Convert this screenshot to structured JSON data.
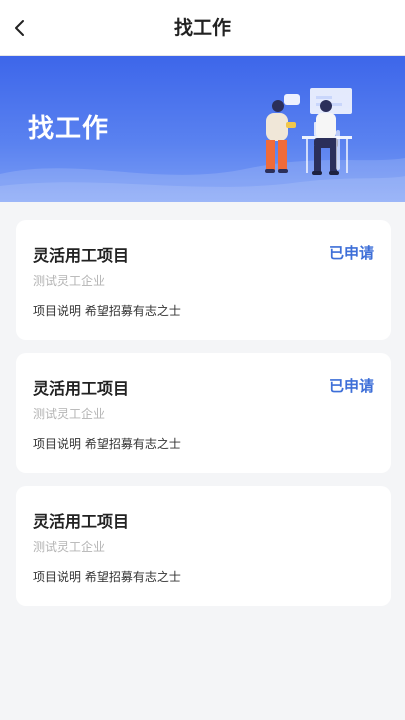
{
  "header": {
    "title": "找工作",
    "back_icon": "chevron-left-icon"
  },
  "banner": {
    "title": "找工作",
    "illustration": "people-working-illustration",
    "colors": {
      "gradient_top": "#3d66ea",
      "gradient_bottom": "#7d9ff6"
    }
  },
  "jobs": [
    {
      "title": "灵活用工项目",
      "company": "测试灵工企业",
      "description": "项目说明 希望招募有志之士",
      "status": "已申请"
    },
    {
      "title": "灵活用工项目",
      "company": "测试灵工企业",
      "description": "项目说明 希望招募有志之士",
      "status": "已申请"
    },
    {
      "title": "灵活用工项目",
      "company": "测试灵工企业",
      "description": "项目说明 希望招募有志之士",
      "status": ""
    }
  ],
  "colors": {
    "accent": "#3e6fd8",
    "background": "#f4f5f7"
  }
}
